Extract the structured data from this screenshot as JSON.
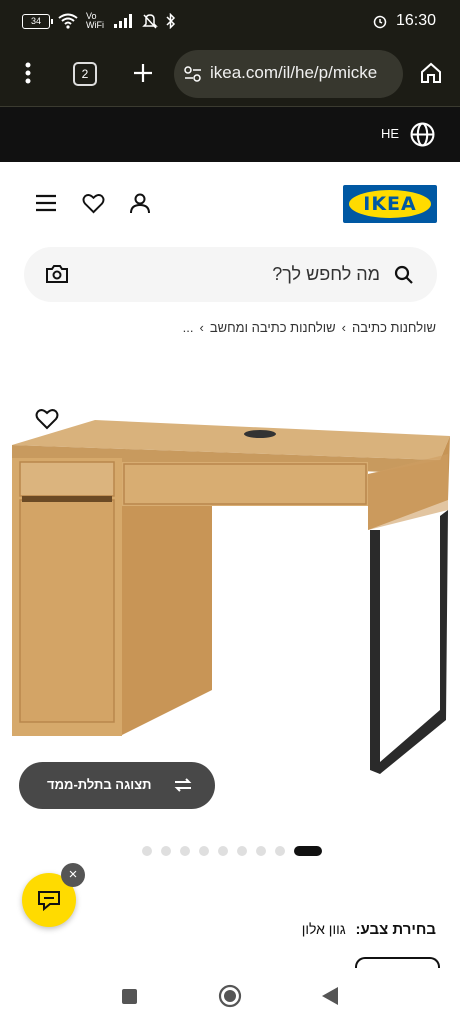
{
  "status_bar": {
    "battery": "34",
    "network_label": "Vo WiFi",
    "time": "16:30"
  },
  "browser": {
    "tab_count": "2",
    "url": "ikea.com/il/he/p/micke"
  },
  "language_bar": {
    "code": "HE"
  },
  "header": {
    "logo_text": "IKEA"
  },
  "search": {
    "placeholder": "מה לחפש לך?"
  },
  "breadcrumb": {
    "ellipsis": "...",
    "items": [
      "שולחנות כתיבה ומחשב",
      "שולחנות כתיבה"
    ]
  },
  "product_image": {
    "view_3d_label": "תצוגה בתלת-ממד",
    "carousel": {
      "total": 9,
      "active_index": 8
    }
  },
  "color_selector": {
    "label": "בחירת צבע:",
    "value": "גוון אלון"
  },
  "colors": {
    "ikea_blue": "#0058a3",
    "ikea_yellow": "#ffdb00",
    "dark_bar": "#1c1c15"
  }
}
